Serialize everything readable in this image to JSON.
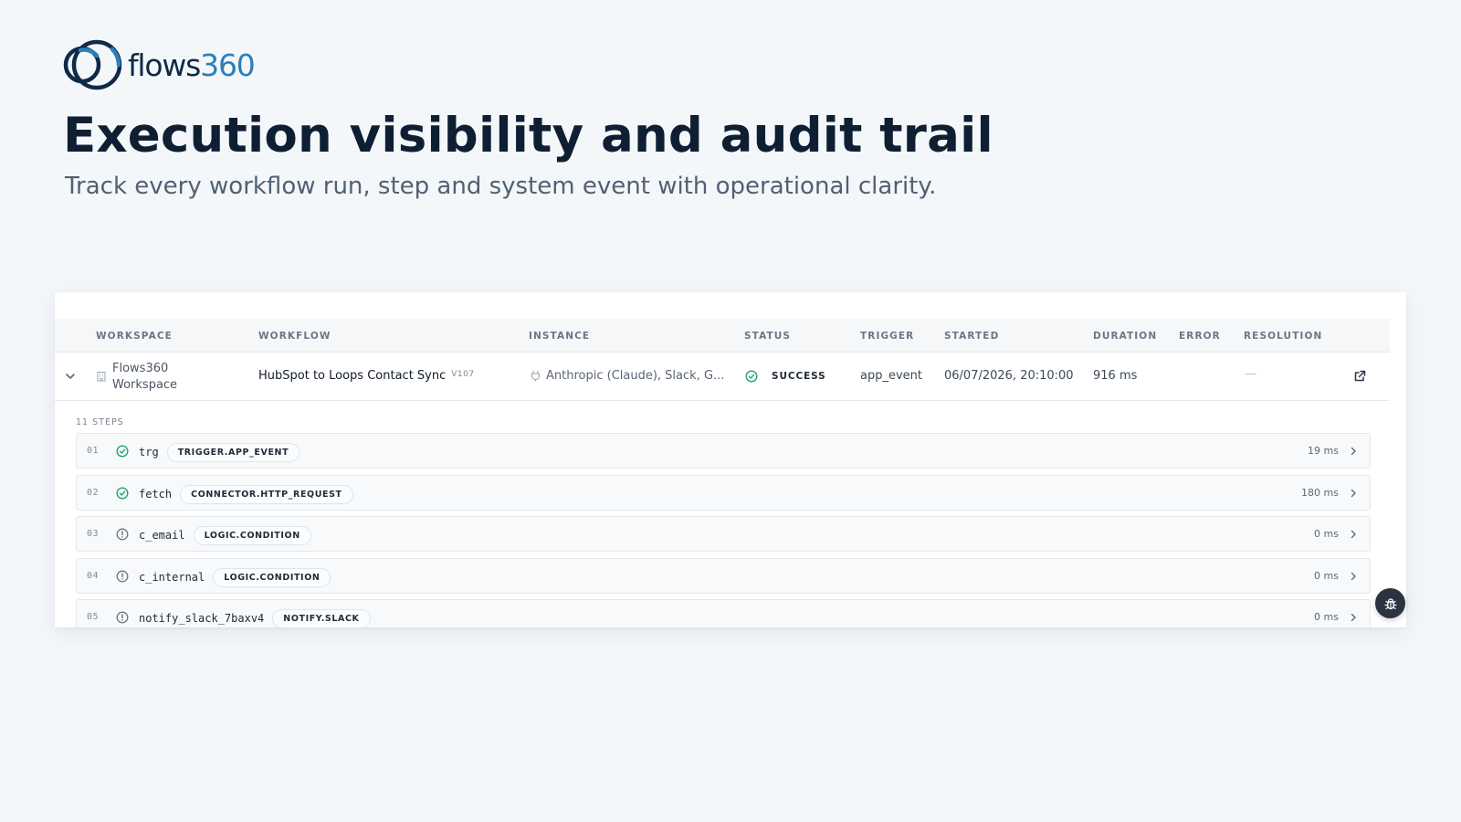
{
  "brand": {
    "word": "flows",
    "number": "360",
    "colors": {
      "dark": "#0f2a47",
      "accent": "#2d7fb8"
    }
  },
  "hero": {
    "title": "Execution visibility and audit trail",
    "subtitle": "Track every workflow run, step and system event with operational clarity."
  },
  "table": {
    "headers": {
      "workspace": "WORKSPACE",
      "workflow": "WORKFLOW",
      "instance": "INSTANCE",
      "status": "STATUS",
      "trigger": "TRIGGER",
      "started": "STARTED",
      "duration": "DURATION",
      "error": "ERROR",
      "resolution": "RESOLUTION"
    },
    "run": {
      "workspace_line1": "Flows360",
      "workspace_line2": "Workspace",
      "workflow": "HubSpot to Loops Contact Sync",
      "version": "V107",
      "instance": "Anthropic (Claude), Slack, G...",
      "status": "SUCCESS",
      "status_color": "#1fa971",
      "trigger": "app_event",
      "started": "06/07/2026, 20:10:00",
      "duration": "916 ms",
      "error": "",
      "resolution": "—"
    }
  },
  "steps_label": "11 STEPS",
  "steps": [
    {
      "num": "01",
      "name": "trg",
      "tag": "TRIGGER.APP_EVENT",
      "duration": "19 ms",
      "state": "success",
      "icon": "check-circle-icon"
    },
    {
      "num": "02",
      "name": "fetch",
      "tag": "CONNECTOR.HTTP_REQUEST",
      "duration": "180 ms",
      "state": "success",
      "icon": "check-circle-icon"
    },
    {
      "num": "03",
      "name": "c_email",
      "tag": "LOGIC.CONDITION",
      "duration": "0 ms",
      "state": "skipped",
      "icon": "info-circle-icon"
    },
    {
      "num": "04",
      "name": "c_internal",
      "tag": "LOGIC.CONDITION",
      "duration": "0 ms",
      "state": "skipped",
      "icon": "info-circle-icon"
    },
    {
      "num": "05",
      "name": "notify_slack_7baxv4",
      "tag": "NOTIFY.SLACK",
      "duration": "0 ms",
      "state": "skipped",
      "icon": "info-circle-icon"
    }
  ]
}
